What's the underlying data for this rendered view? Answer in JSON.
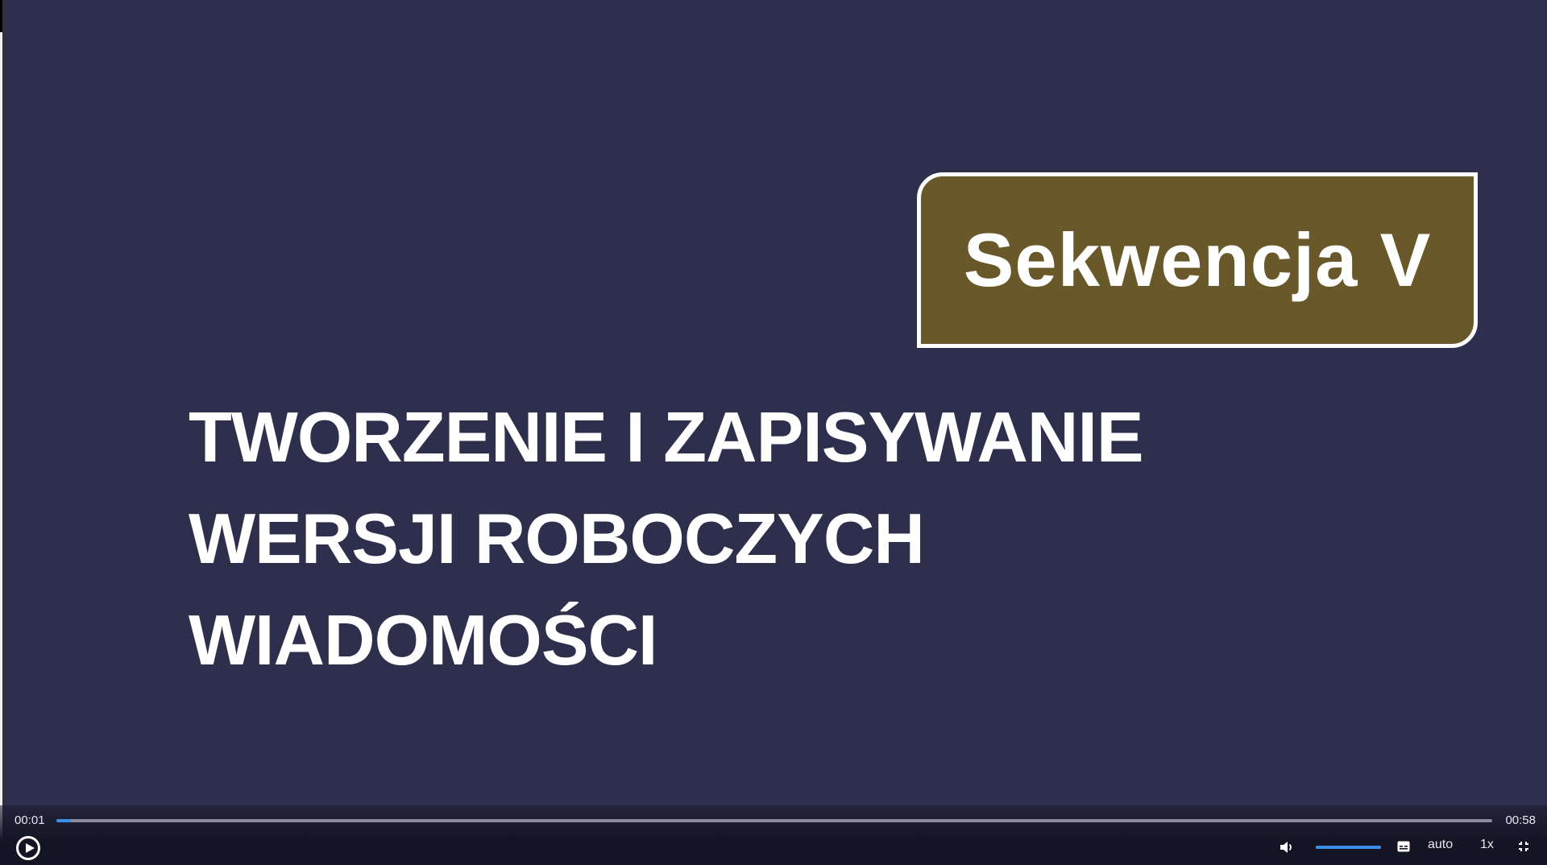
{
  "slide": {
    "badge": "Sekwencja V",
    "title_lines": [
      "TWORZENIE I ZAPISYWANIE",
      "WERSJI ROBOCZYCH",
      "WIADOMOŚCI"
    ]
  },
  "player": {
    "current_time": "00:01",
    "total_time": "00:58",
    "progress_fraction": 0.01,
    "volume_fraction": 1.0,
    "quality": "auto",
    "speed": "1x"
  },
  "colors": {
    "background": "#2e2e4d",
    "badge_fill": "#69582a",
    "accent": "#3b8ee8",
    "text": "#ffffff"
  },
  "icons": {
    "play": "play-icon",
    "volume": "volume-icon",
    "captions": "captions-icon",
    "fullscreen": "exit-fullscreen-icon"
  }
}
